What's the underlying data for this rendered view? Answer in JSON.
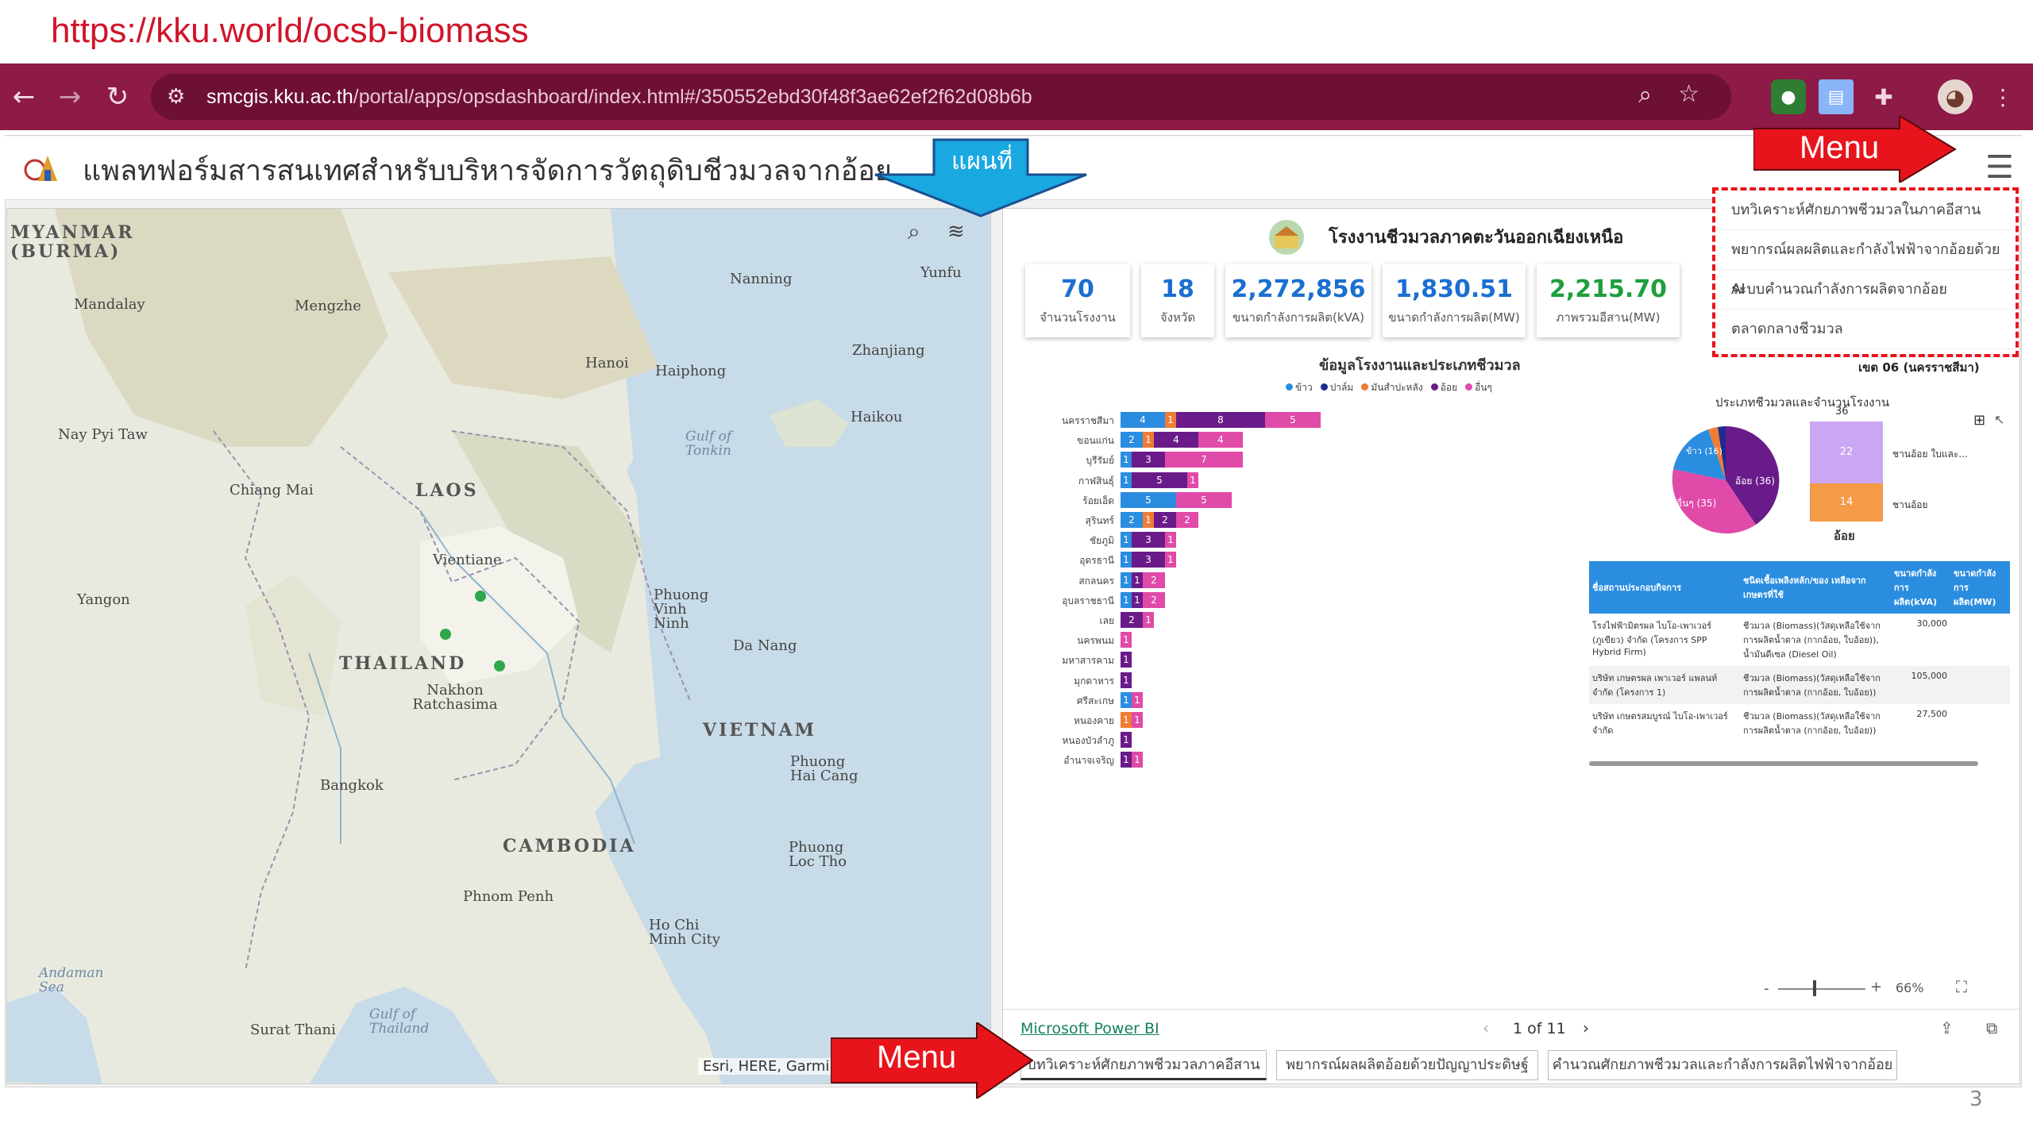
{
  "caption": {
    "url": "https://kku.world/ocsb-biomass"
  },
  "browser": {
    "url_host": "smcgis.kku.ac.th",
    "url_path": "/portal/apps/opsdashboard/index.html#/350552ebd30f48f3ae62ef2f62d08b6b"
  },
  "app": {
    "title": "แพลทฟอร์มสารสนเทศสำหรับบริหารจัดการวัตถุดิบชีวมวลจากอ้อย"
  },
  "callouts": {
    "map_label": "แผนที่",
    "menu_top": "Menu",
    "menu_bottom": "Menu"
  },
  "map": {
    "attribution": "Esri, HERE, Garmin",
    "labels": {
      "myanmar": "MYANMAR (BURMA)",
      "laos": "LAOS",
      "thailand": "THAILAND",
      "vietnam": "VIETNAM",
      "cambodia": "CAMBODIA",
      "mandalay": "Mandalay",
      "mengzhe": "Mengzhe",
      "nanning": "Nanning",
      "yunfu": "Yunfu",
      "zhanjiang": "Zhanjiang",
      "hanoi": "Hanoi",
      "haiphong": "Haiphong",
      "haikou": "Haikou",
      "naypyitaw": "Nay Pyi Taw",
      "chiangmai": "Chiang Mai",
      "vientiane": "Vientiane",
      "yangon": "Yangon",
      "phuongvinh": "Phuong Vinh Ninh",
      "danang": "Da Nang",
      "nakhon": "Nakhon Ratchasima",
      "bangkok": "Bangkok",
      "phuonghai": "Phuong Hai Cang",
      "phnompenh": "Phnom Penh",
      "phuongloc": "Phuong Loc Tho",
      "hcm": "Ho Chi Minh City",
      "suratthani": "Surat Thani",
      "gulf_tonkin": "Gulf of Tonkin",
      "gulf_thailand": "Gulf of Thailand",
      "andaman": "Andaman Sea"
    }
  },
  "dashboard": {
    "title": "โรงงานชีวมวลภาคตะวันออกเฉียงเหนือ",
    "kpis": [
      {
        "value": "70",
        "label": "จำนวนโรงงาน"
      },
      {
        "value": "18",
        "label": "จังหวัด"
      },
      {
        "value": "2,272,856",
        "label": "ขนาดกำลังการผลิต(kVA)"
      },
      {
        "value": "1,830.51",
        "label": "ขนาดกำลังการผลิต(MW)"
      },
      {
        "value": "2,215.70",
        "label": "ภาพรวมอีสาน(MW)"
      }
    ],
    "bar_title": "ข้อมูลโรงงานและประเภทชีวมวล",
    "legend": [
      "ข้าว",
      "ปาล์ม",
      "มันสำปะหลัง",
      "อ้อย",
      "อื่นๆ"
    ],
    "region_note": "เขต 06 (นครราชสีมา)",
    "pie_title": "ประเภทชีวมวลและจำนวนโรงงาน",
    "pie_labels": {
      "sugarcane": "อ้อย (36)",
      "others": "อื่นๆ (35)",
      "rice": "ข้าว (16)"
    },
    "stack_top": "36",
    "stack_values": {
      "a": "22",
      "b": "14"
    },
    "stack_labels": {
      "a": "ชานอ้อย ใบและ...",
      "b": "ชานอ้อย",
      "axis": "อ้อย"
    },
    "table": {
      "headers": [
        "ชื่อสถานประกอบกิจการ",
        "ชนิดเชื้อเพลิงหลัก/ของ เหลือจากเกษตรที่ใช้",
        "ขนาดกำลังการผลิต(kVA)",
        "ขนาดกำลังการผลิต(MW)"
      ],
      "rows": [
        [
          "โรงไฟฟ้ามิตรผล ไบโอ-เพาเวอร์ (ภูเขียว) จำกัด (โครงการ SPP Hybrid Firm)",
          "ชีวมวล (Biomass)(วัสดุเหลือใช้จากการผลิตน้ำตาล (กากอ้อย, ใบอ้อย)), น้ำมันดีเซล (Diesel Oil)",
          "30,000",
          ""
        ],
        [
          "บริษัท เกษตรผล เพาเวอร์ แพลนท์ จำกัด (โครงการ 1)",
          "ชีวมวล (Biomass)(วัสดุเหลือใช้จากการผลิตน้ำตาล (กากอ้อย, ใบอ้อย))",
          "105,000",
          ""
        ],
        [
          "บริษัท เกษตรสมบูรณ์ ไบโอ-เพาเวอร์ จำกัด",
          "ชีวมวล (Biomass)(วัสดุเหลือใช้จากการผลิตน้ำตาล (กากอ้อย, ใบอ้อย))",
          "27,500",
          ""
        ]
      ]
    },
    "zoom": "66%",
    "pbi_link": "Microsoft Power BI",
    "pager": "1 of 11",
    "tabs": [
      "บทวิเคราะห์ศักยภาพชีวมวลภาคอีสาน",
      "พยากรณ์ผลผลิตอ้อยด้วยปัญญาประดิษฐ์",
      "คำนวณศักยภาพชีวมวลและกำลังการผลิตไฟฟ้าจากอ้อย"
    ]
  },
  "menu": {
    "items": [
      "บทวิเคราะห์ศักยภาพชีวมวลในภาคอีสาน",
      "พยากรณ์ผลผลิตและกำลังไฟฟ้าจากอ้อยด้วย AI",
      "ระบบคำนวณกำลังการผลิตจากอ้อย",
      "ตลาดกลางชีวมวล"
    ]
  },
  "slide_number": "3",
  "chart_data": {
    "type": "bar",
    "orientation": "horizontal",
    "stacked": true,
    "title": "ข้อมูลโรงงานและประเภทชีวมวล",
    "categories": [
      "นครราชสีมา",
      "ขอนแก่น",
      "บุรีรัมย์",
      "กาฬสินธุ์",
      "ร้อยเอ็ด",
      "สุรินทร์",
      "ชัยภูมิ",
      "อุดรธานี",
      "สกลนคร",
      "อุบลราชธานี",
      "เลย",
      "นครพนม",
      "มหาสารคาม",
      "มุกดาหาร",
      "ศรีสะเกษ",
      "หนองคาย",
      "หนองบัวลำภู",
      "อำนาจเจริญ"
    ],
    "series": [
      {
        "name": "ข้าว",
        "values": [
          4,
          2,
          1,
          1,
          5,
          2,
          1,
          1,
          1,
          1,
          0,
          0,
          0,
          0,
          1,
          0,
          0,
          0
        ]
      },
      {
        "name": "ปาล์ม",
        "values": [
          0,
          0,
          0,
          0,
          0,
          0,
          0,
          0,
          0,
          0,
          0,
          0,
          0,
          0,
          0,
          0,
          0,
          0
        ]
      },
      {
        "name": "มันสำปะหลัง",
        "values": [
          1,
          1,
          0,
          0,
          0,
          1,
          0,
          0,
          0,
          0,
          0,
          0,
          0,
          0,
          0,
          1,
          0,
          0
        ]
      },
      {
        "name": "อ้อย",
        "values": [
          8,
          4,
          3,
          5,
          0,
          2,
          3,
          3,
          1,
          1,
          2,
          0,
          1,
          1,
          0,
          0,
          1,
          1
        ]
      },
      {
        "name": "อื่นๆ",
        "values": [
          5,
          4,
          7,
          1,
          5,
          2,
          1,
          1,
          2,
          2,
          1,
          1,
          0,
          0,
          1,
          1,
          0,
          1
        ]
      }
    ],
    "colors": {
      "ข้าว": "#2b8de0",
      "ปาล์ม": "#1d2b8f",
      "มันสำปะหลัง": "#f07c34",
      "อ้อย": "#6a1b8a",
      "อื่นๆ": "#e04aa8"
    }
  }
}
